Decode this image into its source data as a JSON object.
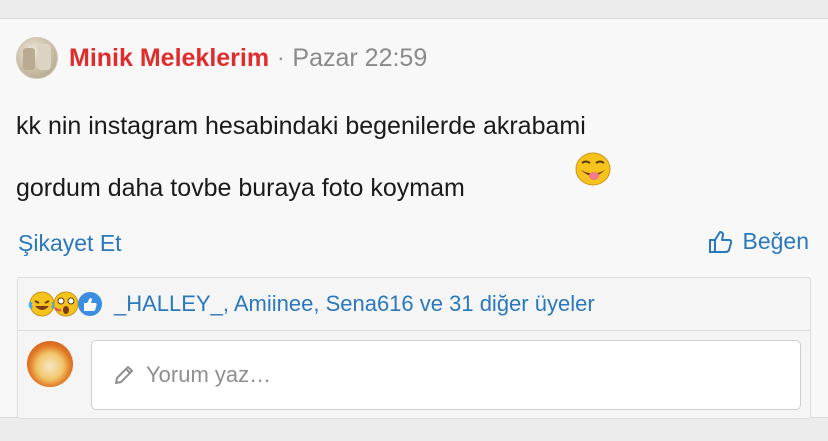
{
  "post": {
    "author": "Minik Meleklerim",
    "separator": "·",
    "timestamp": "Pazar 22:59",
    "text_line1": "kk nin instagram hesabindaki begenilerde akrabami",
    "text_line2": "gordum daha tovbe buraya foto koymam"
  },
  "actions": {
    "complain_label": "Şikayet Et",
    "like_label": "Beğen"
  },
  "reactions": {
    "icons": [
      "laughing-tears-icon",
      "astonished-icon",
      "thumbs-up-icon"
    ],
    "summary": "_HALLEY_, Amiinee, Sena616 ve 31 diğer üyeler"
  },
  "comment": {
    "placeholder": "Yorum yaz…"
  },
  "colors": {
    "author": "#e02c2c",
    "link": "#2a78bd",
    "muted": "#8a8a8a"
  }
}
